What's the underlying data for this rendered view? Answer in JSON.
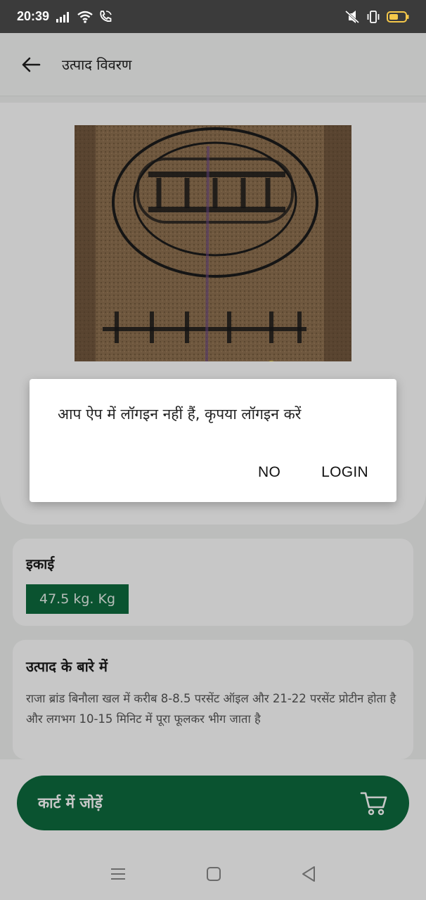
{
  "status_bar": {
    "time": "20:39"
  },
  "app_bar": {
    "title": "उत्पाद विवरण"
  },
  "unit_section": {
    "heading": "इकाई",
    "value": "47.5 kg. Kg"
  },
  "about_section": {
    "heading": "उत्पाद के बारे में",
    "description": "राजा ब्रांड बिनौला खल में करीब 8-8.5  परसेंट ऑइल और  21-22 परसेंट प्रोटीन होता है और लगभग 10-15 मिनिट में पूरा फूलकर भीग जाता है"
  },
  "cart_button": {
    "label": "कार्ट में जोड़ें"
  },
  "dialog": {
    "message": "आप ऐप में लॉगइन नहीं हैं, कृपया लॉगइन करें",
    "no_label": "NO",
    "login_label": "LOGIN"
  },
  "colors": {
    "brand_green": "#0d6b3e",
    "status_bar": "#3b3b3b"
  }
}
